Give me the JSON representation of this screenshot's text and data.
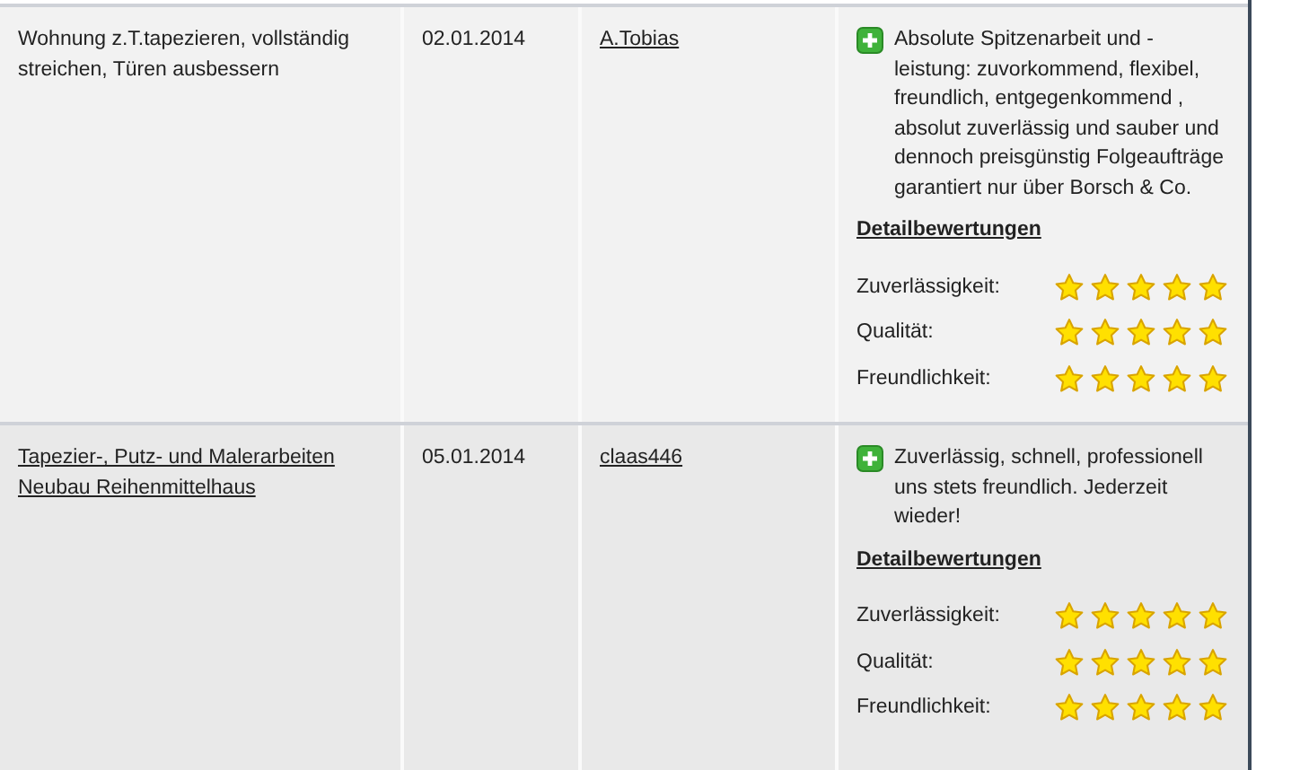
{
  "rows": [
    {
      "project": "Wohnung z.T.tapezieren, vollständig streichen, Türen ausbessern",
      "project_link": false,
      "date": "02.01.2014",
      "user": "A.Tobias",
      "comment": "Absolute Spitzenarbeit und -leistung: zuvorkommend, flexibel, freundlich, entgegenkommend , absolut zuverlässig und sauber und dennoch preisgünstig Folgeaufträge garantiert nur über Borsch & Co.",
      "details_link": "Detailbewertungen",
      "ratings": [
        {
          "label": "Zuverlässigkeit:",
          "stars": 5
        },
        {
          "label": "Qualität:",
          "stars": 5
        },
        {
          "label": "Freundlichkeit:",
          "stars": 5
        }
      ]
    },
    {
      "project": "Tapezier-, Putz- und Malerarbeiten Neubau Reihenmittelhaus",
      "project_link": true,
      "date": "05.01.2014",
      "user": "claas446",
      "comment": "Zuverlässig, schnell, professionell uns stets freundlich. Jederzeit wieder!",
      "details_link": "Detailbewertungen",
      "ratings": [
        {
          "label": "Zuverlässigkeit:",
          "stars": 5
        },
        {
          "label": "Qualität:",
          "stars": 5
        },
        {
          "label": "Freundlichkeit:",
          "stars": 5
        }
      ]
    }
  ]
}
